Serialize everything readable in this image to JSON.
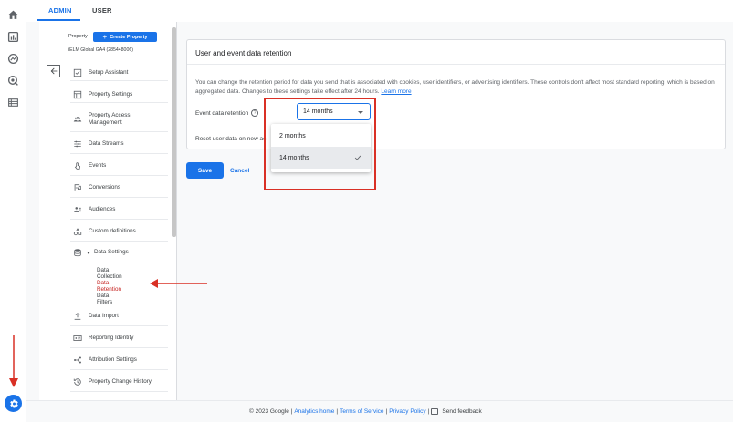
{
  "colors": {
    "accent": "#1a73e8",
    "annotation_red": "#d93025",
    "active_nav": "#c5221f"
  },
  "tabs": [
    {
      "label": "ADMIN",
      "active": true
    },
    {
      "label": "USER",
      "active": false
    }
  ],
  "rail_icons": [
    "home-icon",
    "reports-icon",
    "explore-icon",
    "advertising-icon",
    "list-icon",
    "settings-gear-icon"
  ],
  "property": {
    "label": "Property",
    "create_button": "Create Property",
    "name": "iELM Global GA4 (285448006)"
  },
  "nav": {
    "items": [
      {
        "label": "Setup Assistant",
        "icon": "checkbox-icon"
      },
      {
        "label": "Property Settings",
        "icon": "property-icon"
      },
      {
        "label": "Property Access Management",
        "icon": "people-icon"
      },
      {
        "label": "Data Streams",
        "icon": "streams-icon"
      },
      {
        "label": "Events",
        "icon": "touch-icon"
      },
      {
        "label": "Conversions",
        "icon": "flag-icon"
      },
      {
        "label": "Audiences",
        "icon": "audience-icon"
      },
      {
        "label": "Custom definitions",
        "icon": "shapes-icon"
      },
      {
        "label": "Data Settings",
        "icon": "database-icon"
      }
    ],
    "sub_items": [
      {
        "label": "Data Collection",
        "active": false
      },
      {
        "label": "Data Retention",
        "active": true
      },
      {
        "label": "Data Filters",
        "active": false
      }
    ],
    "items_after": [
      {
        "label": "Data Import",
        "icon": "upload-icon"
      },
      {
        "label": "Reporting Identity",
        "icon": "identity-icon"
      },
      {
        "label": "Attribution Settings",
        "icon": "attribution-icon"
      },
      {
        "label": "Property Change History",
        "icon": "history-icon"
      }
    ]
  },
  "card": {
    "title": "User and event data retention",
    "description": "You can change the retention period for data you send that is associated with cookies, user identifiers, or advertising identifiers. These controls don't affect most standard reporting, which is based on aggregated data. Changes to these settings take effect after 24 hours.",
    "learn_more": "Learn more",
    "retention_label": "Event data retention",
    "help": "?",
    "selected_value": "14 months",
    "reset_label": "Reset user data on new ac"
  },
  "dropdown": {
    "options": [
      {
        "label": "2 months",
        "selected": false
      },
      {
        "label": "14 months",
        "selected": true
      }
    ]
  },
  "actions": {
    "save": "Save",
    "cancel": "Cancel"
  },
  "footer": {
    "copyright": "© 2023 Google |",
    "links": [
      "Analytics home",
      "Terms of Service",
      "Privacy Policy"
    ],
    "separator": "|",
    "feedback": "Send feedback"
  }
}
